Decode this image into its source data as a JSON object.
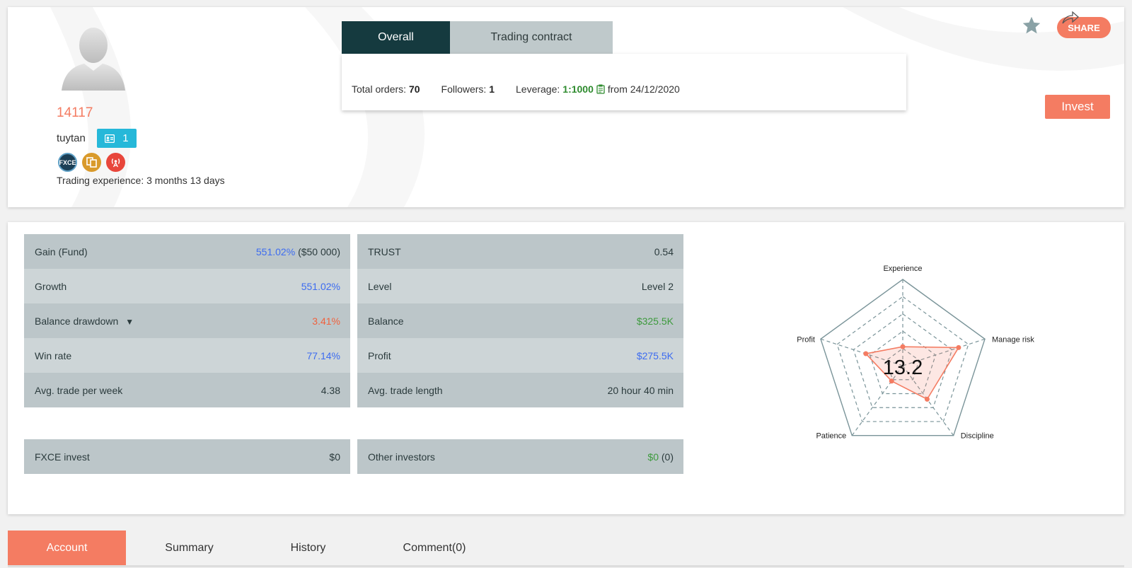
{
  "profile": {
    "id": "14117",
    "username": "tuytan",
    "badge_count": "1",
    "experience": "Trading experience: 3 months 13 days",
    "badge_fxce_label": "FXCE"
  },
  "tabs": [
    {
      "label": "Overall",
      "active": true
    },
    {
      "label": "Trading contract",
      "active": false
    }
  ],
  "info": {
    "total_orders_label": "Total orders:",
    "total_orders_value": "70",
    "followers_label": "Followers:",
    "followers_value": "1",
    "leverage_label": "Leverage:",
    "leverage_value": "1:1000",
    "leverage_from": "from 24/12/2020"
  },
  "actions": {
    "share_label": "SHARE",
    "invest_label": "Invest"
  },
  "stats_left": [
    {
      "label": "Gain (Fund)",
      "value": "551.02%",
      "extra": "($50 000)",
      "color": "blue"
    },
    {
      "label": "Growth",
      "value": "551.02%",
      "extra": "",
      "color": "blue"
    },
    {
      "label": "Balance drawdown",
      "value": "3.41%",
      "extra": "",
      "color": "red"
    },
    {
      "label": "Win rate",
      "value": "77.14%",
      "extra": "",
      "color": "blue"
    },
    {
      "label": "Avg. trade per week",
      "value": "4.38",
      "extra": "",
      "color": "dark"
    }
  ],
  "stats_right": [
    {
      "label": "TRUST",
      "value": "0.54",
      "extra": "",
      "color": "dark"
    },
    {
      "label": "Level",
      "value": "Level 2",
      "extra": "",
      "color": "dark"
    },
    {
      "label": "Balance",
      "value": "$325.5K",
      "extra": "",
      "color": "green"
    },
    {
      "label": "Profit",
      "value": "$275.5K",
      "extra": "",
      "color": "blue"
    },
    {
      "label": "Avg. trade length",
      "value": "20 hour 40 min",
      "extra": "",
      "color": "dark"
    }
  ],
  "invest_left": {
    "label": "FXCE invest",
    "value": "$0"
  },
  "invest_right": {
    "label": "Other investors",
    "value": "$0",
    "extra": "(0)"
  },
  "radar": {
    "score": "13.2",
    "axes": [
      "Experience",
      "Manage risk",
      "Discipline",
      "Patience",
      "Profit"
    ],
    "values": [
      0.22,
      0.68,
      0.48,
      0.22,
      0.45
    ],
    "max": 1,
    "colors": {
      "grid": "#7a9499",
      "fill": "#f47c62"
    }
  },
  "bottom_tabs": [
    {
      "label": "Account",
      "active": true
    },
    {
      "label": "Summary",
      "active": false
    },
    {
      "label": "History",
      "active": false
    },
    {
      "label": "Comment(0)",
      "active": false
    }
  ],
  "colors": {
    "accent": "#f47c62",
    "tab_active": "#153a3f",
    "badge_blue": "#26b8d9"
  }
}
